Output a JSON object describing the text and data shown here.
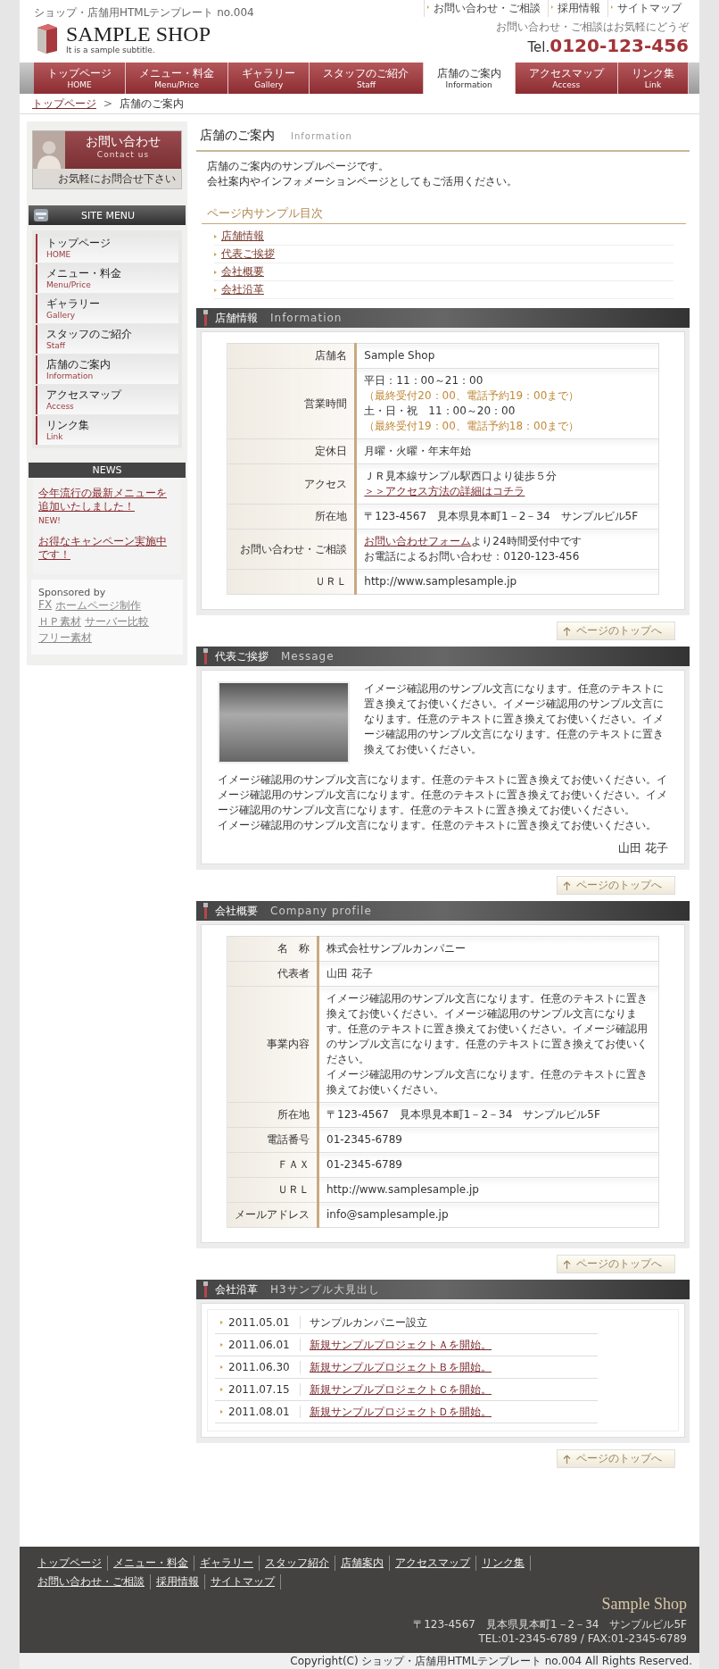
{
  "header": {
    "tagline": "ショップ・店舗用HTMLテンプレート no.004",
    "logo": "SAMPLE SHOP",
    "subtitle": "It is a sample subtitle.",
    "top_links": [
      "お問い合わせ・ご相談",
      "採用情報",
      "サイトマップ"
    ],
    "contact_note": "お問い合わせ・ご相談はお気軽にどうぞ",
    "tel_prefix": "Tel.",
    "tel": "0120-123-456"
  },
  "nav": [
    {
      "label": "トップページ",
      "sub": "HOME",
      "selected": false
    },
    {
      "label": "メニュー・料金",
      "sub": "Menu/Price",
      "selected": false
    },
    {
      "label": "ギャラリー",
      "sub": "Gallery",
      "selected": false
    },
    {
      "label": "スタッフのご紹介",
      "sub": "Staff",
      "selected": false
    },
    {
      "label": "店舗のご案内",
      "sub": "Information",
      "selected": true
    },
    {
      "label": "アクセスマップ",
      "sub": "Access",
      "selected": false
    },
    {
      "label": "リンク集",
      "sub": "Link",
      "selected": false
    }
  ],
  "breadcrumb": {
    "separator": ">",
    "items": [
      {
        "label": "トップページ",
        "link": true
      },
      {
        "label": "店舗のご案内",
        "link": false
      }
    ]
  },
  "sidebar": {
    "contact_banner": {
      "title": "お問い合わせ",
      "subtitle": "Contact us",
      "note": "お気軽にお問合せ下さい"
    },
    "site_menu": {
      "title": "SITE MENU",
      "items": [
        {
          "label": "トップページ",
          "sub": "HOME"
        },
        {
          "label": "メニュー・料金",
          "sub": "Menu/Price"
        },
        {
          "label": "ギャラリー",
          "sub": "Gallery"
        },
        {
          "label": "スタッフのご紹介",
          "sub": "Staff"
        },
        {
          "label": "店舗のご案内",
          "sub": "Information"
        },
        {
          "label": "アクセスマップ",
          "sub": "Access"
        },
        {
          "label": "リンク集",
          "sub": "Link"
        }
      ]
    },
    "news": {
      "title": "NEWS",
      "items": [
        {
          "text": "今年流行の最新メニューを追加いたしました！",
          "badge": "NEW!"
        },
        {
          "text": "お得なキャンペーン実施中です！"
        }
      ]
    },
    "sponsored": {
      "title": "Sponsored by",
      "links": [
        "FX",
        "ホームページ制作",
        "ＨＰ素材",
        "サーバー比較",
        "フリー素材"
      ]
    }
  },
  "main": {
    "title": "店舗のご案内",
    "title_en": "Information",
    "intro": [
      "店舗のご案内のサンプルページです。",
      "会社案内やインフォメーションページとしてもご活用ください。"
    ],
    "toc": {
      "heading": "ページ内サンプル目次",
      "items": [
        "店舗情報",
        "代表ご挨拶",
        "会社概要",
        "会社沿革"
      ]
    },
    "sections": [
      {
        "kind": "table",
        "title": "店舗情報",
        "title_en": "Information",
        "page_top": "ページのトップへ",
        "rows": [
          {
            "label": "店舗名",
            "lines": [
              [
                {
                  "text": "Sample Shop",
                  "kind": "text"
                }
              ]
            ]
          },
          {
            "label": "営業時間",
            "lines": [
              [
                {
                  "text": "平日：11：00～21：00",
                  "kind": "text"
                }
              ],
              [
                {
                  "text": "（最終受付20：00、電話予約19：00まで）",
                  "kind": "note"
                }
              ],
              [
                {
                  "text": "土・日・祝　11：00～20：00",
                  "kind": "text"
                }
              ],
              [
                {
                  "text": "（最終受付19：00、電話予約18：00まで）",
                  "kind": "note"
                }
              ]
            ]
          },
          {
            "label": "定休日",
            "lines": [
              [
                {
                  "text": "月曜・火曜・年末年始",
                  "kind": "text"
                }
              ]
            ]
          },
          {
            "label": "アクセス",
            "lines": [
              [
                {
                  "text": "ＪＲ見本線サンプル駅西口より徒歩５分",
                  "kind": "text"
                }
              ],
              [
                {
                  "text": "＞＞アクセス方法の詳細はコチラ",
                  "kind": "link"
                }
              ]
            ]
          },
          {
            "label": "所在地",
            "lines": [
              [
                {
                  "text": "〒123-4567　見本県見本町1－2－34　サンプルビル5F",
                  "kind": "text"
                }
              ]
            ]
          },
          {
            "label": "お問い合わせ・ご相談",
            "lines": [
              [
                {
                  "text": "お問い合わせフォーム",
                  "kind": "link"
                },
                {
                  "text": "より24時間受付中です",
                  "kind": "text"
                }
              ],
              [
                {
                  "text": "お電話によるお問い合わせ：0120-123-456",
                  "kind": "text"
                }
              ]
            ]
          },
          {
            "label": "ＵＲＬ",
            "lines": [
              [
                {
                  "text": "http://www.samplesample.jp",
                  "kind": "text"
                }
              ]
            ]
          }
        ]
      },
      {
        "kind": "message",
        "title": "代表ご挨拶",
        "title_en": "Message",
        "page_top": "ページのトップへ",
        "paragraphs": [
          [
            "イメージ確認用のサンプル文言になります。任意のテキストに置き換えてお使いください。イメージ確認用のサンプル文言になります。任意のテキストに置き換えてお使いください。イメージ確認用のサンプル文言になります。任意のテキストに置き換えてお使いください。"
          ],
          [
            "イメージ確認用のサンプル文言になります。任意のテキストに置き換えてお使いください。イメージ確認用のサンプル文言になります。任意のテキストに置き換えてお使いください。イメージ確認用のサンプル文言になります。任意のテキストに置き換えてお使いください。",
            "イメージ確認用のサンプル文言になります。任意のテキストに置き換えてお使いください。"
          ]
        ],
        "signature": "山田 花子"
      },
      {
        "kind": "table",
        "title": "会社概要",
        "title_en": "Company profile",
        "page_top": "ページのトップへ",
        "rows": [
          {
            "label": "名　称",
            "lines": [
              [
                {
                  "text": "株式会社サンプルカンパニー",
                  "kind": "text"
                }
              ]
            ]
          },
          {
            "label": "代表者",
            "lines": [
              [
                {
                  "text": "山田 花子",
                  "kind": "text"
                }
              ]
            ]
          },
          {
            "label": "事業内容",
            "lines": [
              [
                {
                  "text": "イメージ確認用のサンプル文言になります。任意のテキストに置き換えてお使いください。イメージ確認用のサンプル文言になります。任意のテキストに置き換えてお使いください。イメージ確認用のサンプル文言になります。任意のテキストに置き換えてお使いください。",
                  "kind": "text"
                }
              ],
              [
                {
                  "text": "イメージ確認用のサンプル文言になります。任意のテキストに置き換えてお使いください。",
                  "kind": "text"
                }
              ]
            ]
          },
          {
            "label": "所在地",
            "lines": [
              [
                {
                  "text": "〒123-4567　見本県見本町1－2－34　サンプルビル5F",
                  "kind": "text"
                }
              ]
            ]
          },
          {
            "label": "電話番号",
            "lines": [
              [
                {
                  "text": "01-2345-6789",
                  "kind": "text"
                }
              ]
            ]
          },
          {
            "label": "ＦＡＸ",
            "lines": [
              [
                {
                  "text": "01-2345-6789",
                  "kind": "text"
                }
              ]
            ]
          },
          {
            "label": "ＵＲＬ",
            "lines": [
              [
                {
                  "text": "http://www.samplesample.jp",
                  "kind": "text"
                }
              ]
            ]
          },
          {
            "label": "メールアドレス",
            "lines": [
              [
                {
                  "text": "info@samplesample.jp",
                  "kind": "text"
                }
              ]
            ]
          }
        ]
      },
      {
        "kind": "history",
        "title": "会社沿革",
        "title_en": "H3サンプル大見出し",
        "page_top": "ページのトップへ",
        "rows": [
          {
            "date": "2011.05.01",
            "text": "サンプルカンパニー設立",
            "link": false
          },
          {
            "date": "2011.06.01",
            "text": "新規サンプルプロジェクトＡを開始。",
            "link": true
          },
          {
            "date": "2011.06.30",
            "text": "新規サンプルプロジェクトＢを開始。",
            "link": true
          },
          {
            "date": "2011.07.15",
            "text": "新規サンプルプロジェクトＣを開始。",
            "link": true
          },
          {
            "date": "2011.08.01",
            "text": "新規サンプルプロジェクトＤを開始。",
            "link": true
          }
        ]
      }
    ]
  },
  "footer": {
    "link_rows": [
      [
        "トップページ",
        "メニュー・料金",
        "ギャラリー",
        "スタッフ紹介",
        "店舗案内",
        "アクセスマップ",
        "リンク集"
      ],
      [
        "お問い合わせ・ご相談",
        "採用情報",
        "サイトマップ"
      ]
    ],
    "shop": "Sample Shop",
    "address": "〒123-4567　見本県見本町1－2－34　サンプルビル5F",
    "tel": "TEL:01-2345-6789 / FAX:01-2345-6789",
    "copyright": "Copyright(C) ショップ・店舗用HTMLテンプレート no.004 All Rights Reserved."
  }
}
